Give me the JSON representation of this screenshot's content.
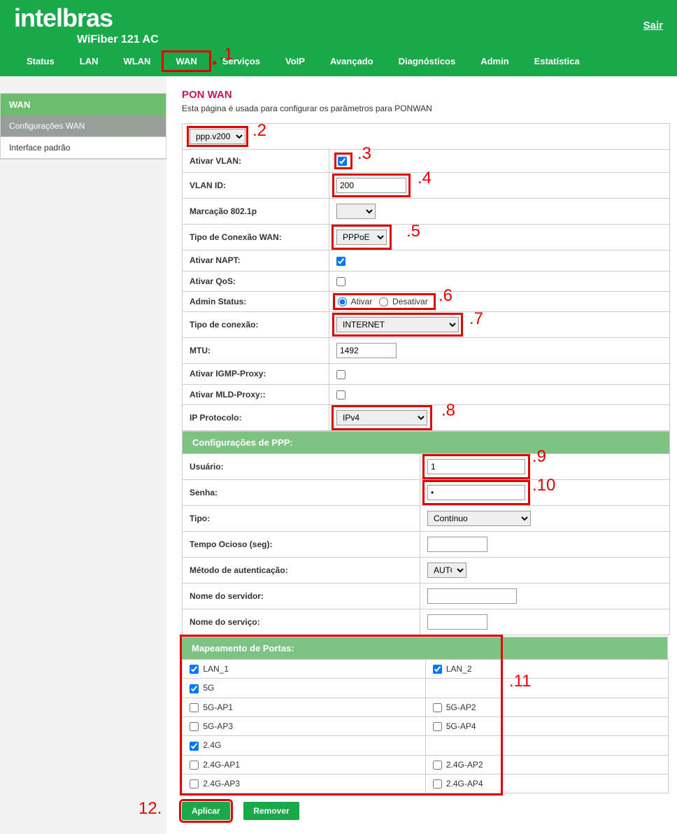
{
  "header": {
    "brand": "intelbras",
    "model": "WiFiber 121 AC",
    "logout": "Sair"
  },
  "nav": {
    "status": "Status",
    "lan": "LAN",
    "wlan": "WLAN",
    "wan": "WAN",
    "servicos": "Serviços",
    "voip": "VoIP",
    "avancado": "Avançado",
    "diagnosticos": "Diagnósticos",
    "admin": "Admin",
    "estatistica": "Estatística"
  },
  "sidebar": {
    "title": "WAN",
    "items": [
      "Configurações WAN",
      "Interface padrão"
    ]
  },
  "page": {
    "title": "PON WAN",
    "desc": "Esta página é usada para configurar os parâmetros para PONWAN"
  },
  "fields": {
    "profile_select": "ppp.v200",
    "ativar_vlan_label": "Ativar VLAN:",
    "ativar_vlan": true,
    "vlan_id_label": "VLAN ID:",
    "vlan_id": "200",
    "marcacao_label": "Marcação 802.1p",
    "marcacao_value": "",
    "tipo_conexao_wan_label": "Tipo de Conexão WAN:",
    "tipo_conexao_wan": "PPPoE",
    "ativar_napt_label": "Ativar NAPT:",
    "ativar_napt": true,
    "ativar_qos_label": "Ativar QoS:",
    "ativar_qos": false,
    "admin_status_label": "Admin Status:",
    "admin_status_ativar": "Ativar",
    "admin_status_desativar": "Desativar",
    "tipo_conexao_label": "Tipo de conexão:",
    "tipo_conexao": "INTERNET",
    "mtu_label": "MTU:",
    "mtu": "1492",
    "igmp_label": "Ativar IGMP-Proxy:",
    "igmp": false,
    "mld_label": "Ativar MLD-Proxy::",
    "mld": false,
    "ip_proto_label": "IP Protocolo:",
    "ip_proto": "IPv4"
  },
  "ppp": {
    "section": "Configurações de PPP:",
    "usuario_label": "Usuário:",
    "usuario": "1",
    "senha_label": "Senha:",
    "senha": "•",
    "tipo_label": "Tipo:",
    "tipo": "Contínuo",
    "tempo_label": "Tempo Ocioso (seg):",
    "tempo": "",
    "metodo_label": "Método de autenticação:",
    "metodo": "AUTO",
    "servidor_label": "Nome do servidor:",
    "servidor": "",
    "servico_label": "Nome do serviço:",
    "servico": ""
  },
  "ports": {
    "section": "Mapeamento de Portas:",
    "rows": [
      {
        "l": "LAN_1",
        "lc": true,
        "r": "LAN_2",
        "rc": true
      },
      {
        "l": "5G",
        "lc": true,
        "r": "",
        "rc": null
      },
      {
        "l": "5G-AP1",
        "lc": false,
        "r": "5G-AP2",
        "rc": false
      },
      {
        "l": "5G-AP3",
        "lc": false,
        "r": "5G-AP4",
        "rc": false
      },
      {
        "l": "2.4G",
        "lc": true,
        "r": "",
        "rc": null
      },
      {
        "l": "2.4G-AP1",
        "lc": false,
        "r": "2.4G-AP2",
        "rc": false
      },
      {
        "l": "2.4G-AP3",
        "lc": false,
        "r": "2.4G-AP4",
        "rc": false
      }
    ]
  },
  "buttons": {
    "aplicar": "Aplicar",
    "remover": "Remover"
  },
  "annotations": {
    "a1": ".1",
    "a2": ".2",
    "a3": ".3",
    "a4": ".4",
    "a5": ".5",
    "a6": ".6",
    "a7": ".7",
    "a8": ".8",
    "a9": ".9",
    "a10": ".10",
    "a11": ".11",
    "a12": "12."
  }
}
